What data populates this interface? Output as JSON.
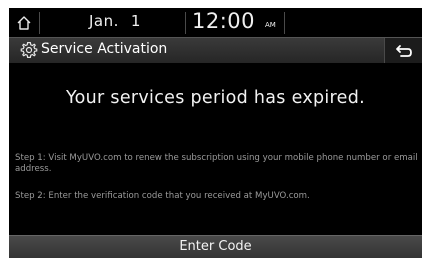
{
  "status_bar": {
    "date_month": "Jan.",
    "date_day": "1",
    "time": "12:00",
    "ampm": "AM",
    "home_icon": "home-icon"
  },
  "header": {
    "title": "Service Activation",
    "settings_icon": "gear-icon",
    "back_icon": "back-arrow-icon"
  },
  "main": {
    "heading": "Your services period has expired.",
    "step1": "Step 1: Visit MyUVO.com to renew the subscription using your mobile phone number or email address.",
    "step2": "Step 2: Enter the verification code that you received at MyUVO.com."
  },
  "footer": {
    "enter_code_label": "Enter Code"
  },
  "colors": {
    "background": "#000000",
    "title_bar": "#2e2e2e",
    "text_primary": "#f2f2f2",
    "text_secondary": "#9a9a9a",
    "button": "#3e3e3e"
  }
}
